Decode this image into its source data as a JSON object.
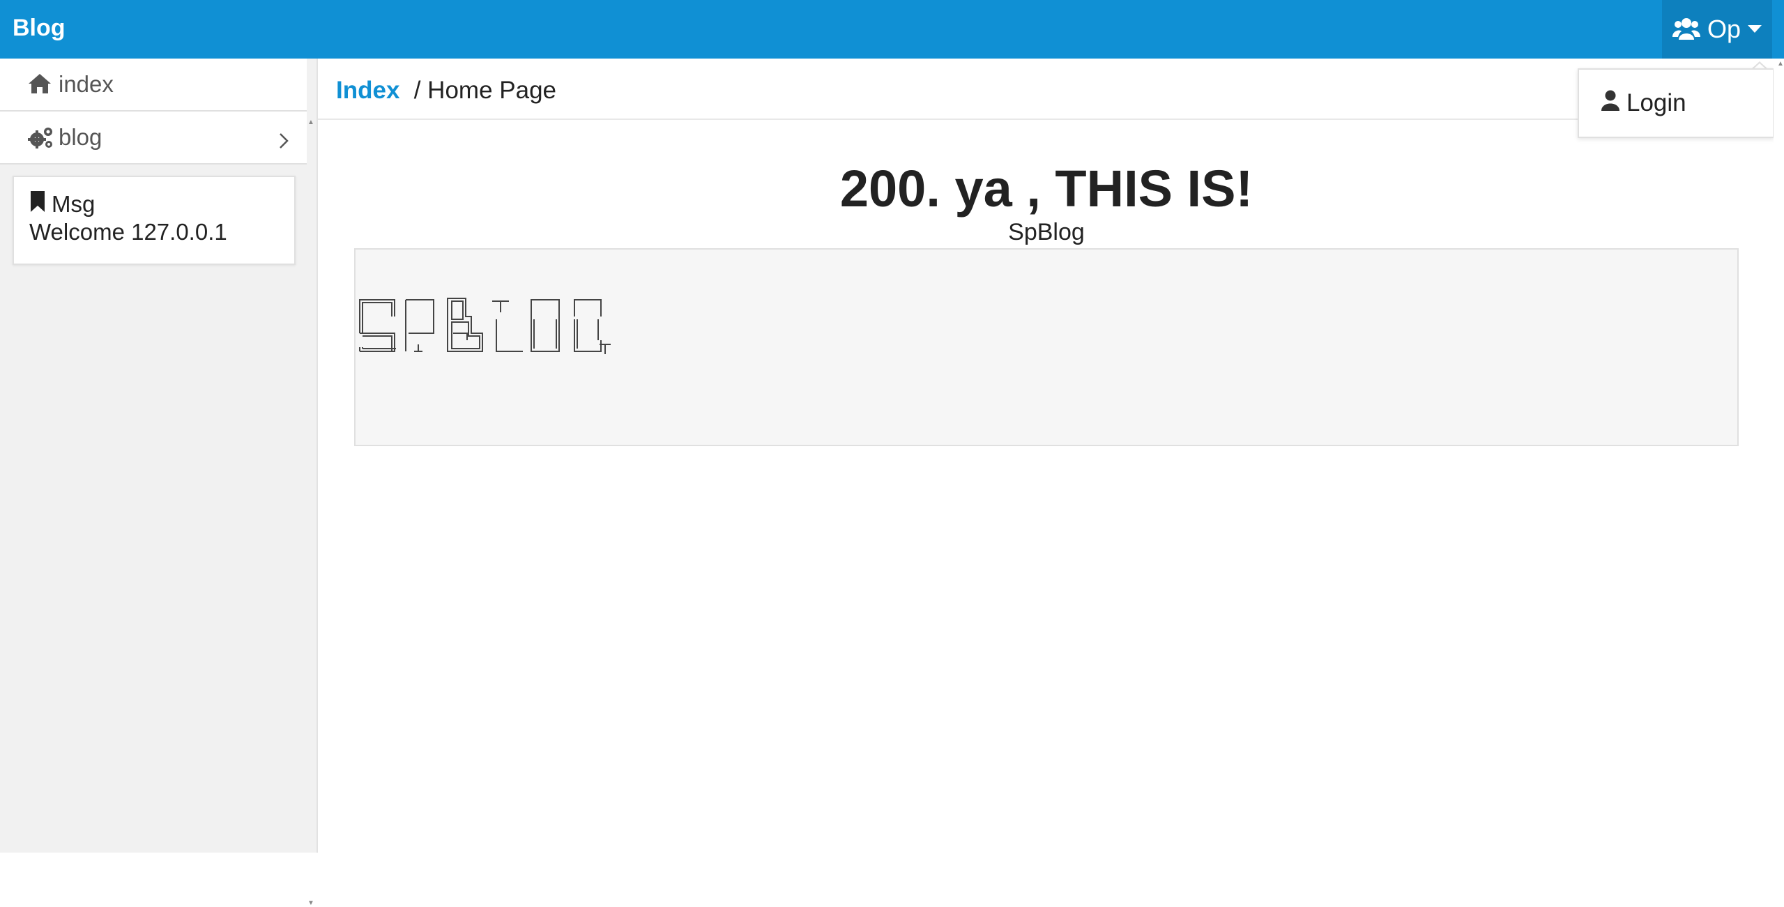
{
  "header": {
    "brand": "Blog",
    "user_menu_label": "Op",
    "brand_color": "#1090d4"
  },
  "sidebar": {
    "items": [
      {
        "label": "index",
        "icon": "home-icon"
      },
      {
        "label": "blog",
        "icon": "gears-icon",
        "chevron": "chevron-right-icon"
      }
    ],
    "msg": {
      "title": "Msg",
      "icon": "bookmark-icon",
      "text": "Welcome 127.0.0.1"
    }
  },
  "breadcrumb": {
    "link": "Index",
    "current": " / Home Page"
  },
  "main": {
    "title": "200. ya , THIS IS!",
    "subtitle": "SpBlog"
  },
  "dropdown": {
    "items": [
      {
        "label": "Login",
        "icon": "user-icon"
      }
    ]
  }
}
